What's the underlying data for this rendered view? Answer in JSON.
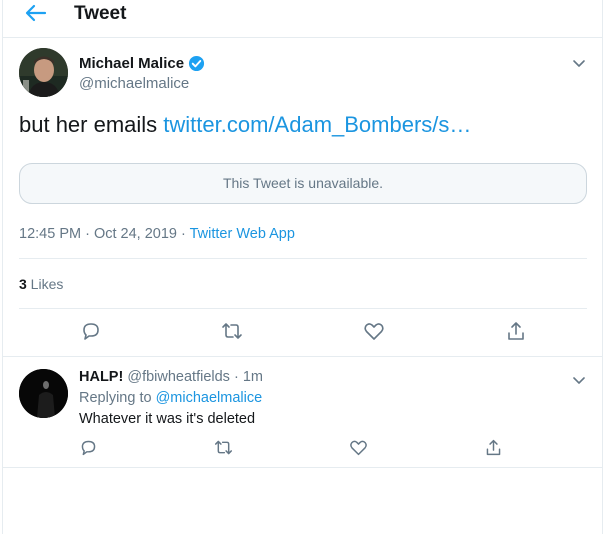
{
  "header": {
    "title": "Tweet",
    "back_icon": "arrow-left-icon"
  },
  "colors": {
    "accent": "#1da1f2",
    "link": "#1b95e0",
    "muted": "#657786",
    "border": "#e6ecf0"
  },
  "tweet": {
    "author_name": "Michael Malice",
    "author_handle": "@michaelmalice",
    "verified_icon": "verified-badge-icon",
    "text_prefix": "but her emails ",
    "text_link": "twitter.com/Adam_Bombers/s…",
    "quoted_notice": "This Tweet is unavailable.",
    "time": "12:45 PM",
    "sep1": " · ",
    "date": "Oct 24, 2019",
    "sep2": " · ",
    "source": "Twitter Web App",
    "likes_count": "3",
    "likes_label": " Likes",
    "actions": [
      "reply-icon",
      "retweet-icon",
      "like-icon",
      "share-icon"
    ]
  },
  "reply": {
    "name": "HALP!",
    "handle": "@fbiwheatfields",
    "sep": " · ",
    "time": "1m",
    "replying_prefix": "Replying to ",
    "replying_handle": "@michaelmalice",
    "text": "Whatever it was it's deleted",
    "actions": [
      "reply-icon",
      "retweet-icon",
      "like-icon",
      "share-icon"
    ]
  }
}
